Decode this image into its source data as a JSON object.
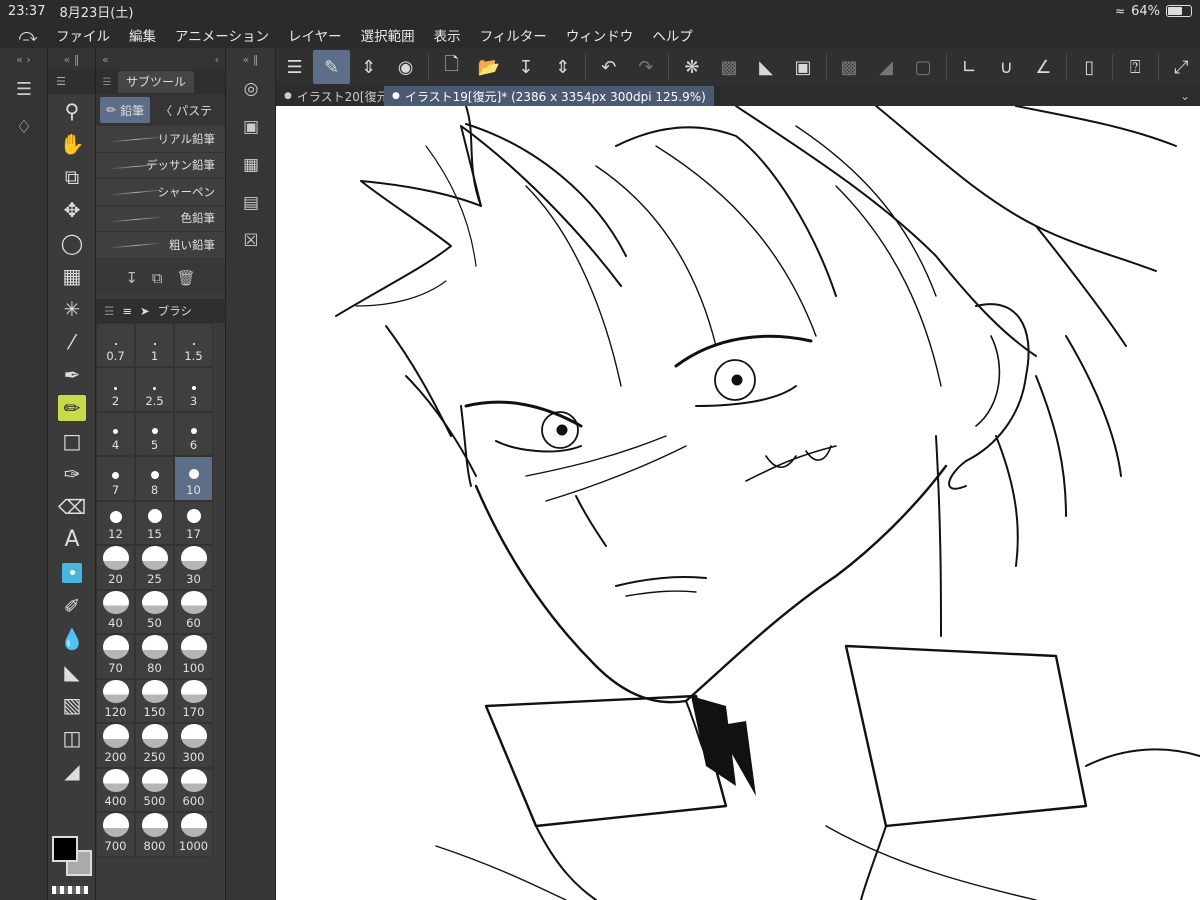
{
  "status": {
    "time": "23:37",
    "date": "8月23日(土)",
    "wifi_icon": "wifi-icon",
    "battery": "64%",
    "battery_level": 0.64
  },
  "menu": {
    "logo_icon": "clip-studio-logo-icon",
    "items": [
      "ファイル",
      "編集",
      "アニメーション",
      "レイヤー",
      "選択範囲",
      "表示",
      "フィルター",
      "ウィンドウ",
      "ヘルプ"
    ]
  },
  "left_strip": {
    "icons": [
      "layers-icon",
      "layer-property-icon"
    ]
  },
  "tools": {
    "icons": [
      "zoom-icon",
      "hand-icon",
      "object-icon",
      "move-icon",
      "lasso-icon",
      "grid-icon",
      "magic-wand-icon",
      "eyedropper-icon",
      "pen-icon",
      "pencil-icon",
      "rectangle-icon",
      "brush-icon",
      "eraser-icon",
      "text-icon",
      "decoration-icon",
      "blend-icon",
      "water-drop-icon",
      "fill-icon",
      "gradient-icon",
      "frame-icon",
      "ruler-icon"
    ],
    "selected": "pencil-icon"
  },
  "subtool": {
    "header": "サブツール",
    "tabs": [
      "鉛筆",
      "パステ"
    ],
    "brushes": [
      "リアル鉛筆",
      "デッサン鉛筆",
      "シャーペン",
      "色鉛筆",
      "粗い鉛筆"
    ]
  },
  "brush_size": {
    "header": "ブラシ",
    "values": [
      "0.7",
      "1",
      "1.5",
      "2",
      "2.5",
      "3",
      "4",
      "5",
      "6",
      "7",
      "8",
      "10",
      "12",
      "15",
      "17",
      "20",
      "25",
      "30",
      "40",
      "50",
      "60",
      "70",
      "80",
      "100",
      "120",
      "150",
      "170",
      "200",
      "250",
      "300",
      "400",
      "500",
      "600",
      "700",
      "800",
      "1000"
    ],
    "selected": "10"
  },
  "mini_strip": {
    "icons": [
      "navigator-icon",
      "material-icon",
      "color-set-icon",
      "timeline-icon",
      "tool-property-icon"
    ]
  },
  "command_bar": {
    "icons": [
      "menu-icon",
      "edit-mode-icon",
      "up-down-icon",
      "clip-studio-icon",
      "new-file-icon",
      "open-icon",
      "save-icon",
      "up-down-icon",
      "undo-icon",
      "redo-icon",
      "loading-icon",
      "transform-icon",
      "fill-bucket-icon",
      "crop-icon",
      "clear-icon",
      "fill-gray-icon",
      "deselect-icon",
      "ruler-snap-icon",
      "brush-snap-icon",
      "line-snap-icon",
      "phone-icon",
      "help-icon",
      "expand-icon"
    ]
  },
  "doc_tabs": [
    {
      "label": "イラスト20[復元",
      "active": false
    },
    {
      "label": "イラスト19[復元]* (2386 x 3354px 300dpi 125.9%)",
      "active": true
    }
  ]
}
